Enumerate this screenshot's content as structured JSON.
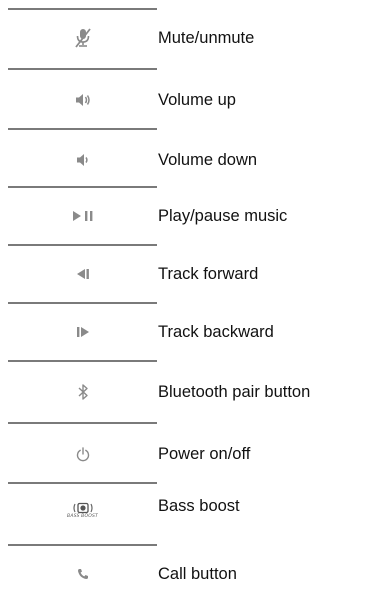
{
  "controls": [
    {
      "icon": "mute-mic-icon",
      "label": "Mute/unmute"
    },
    {
      "icon": "volume-up-icon",
      "label": "Volume up"
    },
    {
      "icon": "volume-down-icon",
      "label": "Volume down"
    },
    {
      "icon": "play-pause-icon",
      "label": "Play/pause music"
    },
    {
      "icon": "track-forward-icon",
      "label": "Track forward"
    },
    {
      "icon": "track-backward-icon",
      "label": "Track backward"
    },
    {
      "icon": "bluetooth-icon",
      "label": "Bluetooth pair button"
    },
    {
      "icon": "power-icon",
      "label": "Power on/off"
    },
    {
      "icon": "bass-boost-icon",
      "label": "Bass boost",
      "icon_caption": "BASS BOOST"
    },
    {
      "icon": "phone-icon",
      "label": "Call button"
    }
  ],
  "colors": {
    "icon": "#8a8a8a",
    "rule": "#7a7a7a",
    "text": "#111111"
  }
}
